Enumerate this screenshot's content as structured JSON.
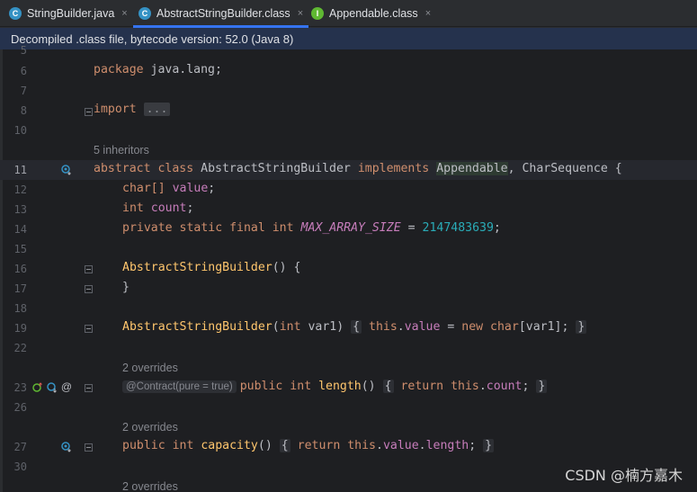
{
  "tabs": [
    {
      "label": "StringBuilder.java",
      "icon": "java-class-icon",
      "icon_letter": "C",
      "icon_color": "#3592c4",
      "active": false
    },
    {
      "label": "AbstractStringBuilder.class",
      "icon": "abstract-class-icon",
      "icon_letter": "C",
      "icon_color": "#3592c4",
      "active": true
    },
    {
      "label": "Appendable.class",
      "icon": "interface-icon",
      "icon_letter": "I",
      "icon_color": "#5fb832",
      "active": false
    }
  ],
  "close_glyph": "×",
  "banner": {
    "text": "Decompiled .class file, bytecode version: 52.0 (Java 8)"
  },
  "line_numbers": {
    "l5": "5",
    "l6": "6",
    "l7": "7",
    "l8": "8",
    "l10": "10",
    "l11": "11",
    "l12": "12",
    "l13": "13",
    "l14": "14",
    "l15": "15",
    "l16": "16",
    "l17": "17",
    "l18": "18",
    "l19": "19",
    "l22": "22",
    "l23": "23",
    "l26": "26",
    "l27": "27",
    "l30": "30"
  },
  "code": {
    "package_kw": "package",
    "package_name": " java.lang;",
    "import_kw": "import",
    "import_collapsed": "...",
    "inheritors_hint": "5 inheritors",
    "class_line": {
      "abstract": "abstract",
      "class": "class",
      "name": "AbstractStringBuilder",
      "implements": "implements",
      "iface1": "Appendable",
      "iface2": "CharSequence",
      "open": "{"
    },
    "field1": {
      "type": "char[]",
      "name": "value"
    },
    "field2": {
      "type": "int",
      "name": "count"
    },
    "field3": {
      "mods": "private static final int",
      "name": "MAX_ARRAY_SIZE",
      "eq": " = ",
      "value": "2147483639"
    },
    "ctor1": {
      "name": "AbstractStringBuilder",
      "sig": "() {"
    },
    "ctor1_close": "}",
    "ctor2": {
      "name": "AbstractStringBuilder",
      "p_type": "int",
      "p_name": " var1)",
      "body_this": "this",
      "body_field": "value",
      "body_new": "new",
      "body_type": "char",
      "body_rest": "[var1];"
    },
    "overrides_hint_1": "2 overrides",
    "length": {
      "anno": "@Contract(pure = true)",
      "mods": "public int",
      "name": "length",
      "sig": "()",
      "ret": "return",
      "this": "this",
      "field": "count"
    },
    "overrides_hint_2": "2 overrides",
    "capacity": {
      "mods": "public int",
      "name": "capacity",
      "sig": "()",
      "ret": "return",
      "this": "this",
      "field1": "value",
      "field2": "length"
    },
    "overrides_hint_3": "2 overrides"
  },
  "gutter_icons": {
    "l11": "implements-icon",
    "l23": [
      "overrides-up-icon",
      "overridden-down-icon",
      "annotation-icon"
    ],
    "l27": "overridden-icon"
  },
  "watermark": "CSDN @楠方嘉木"
}
